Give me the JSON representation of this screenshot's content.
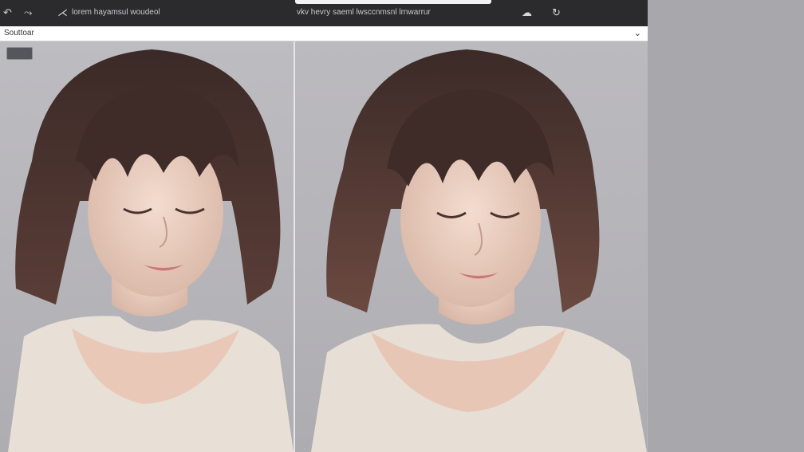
{
  "toolbar": {
    "title_text": "lorem hayamsul woudeol",
    "center_text": "vkv hevry saeml lwsccnmsnl lrnwarrur"
  },
  "tab": {
    "label": "Souttoar"
  },
  "icons": [
    "back-icon",
    "tools-icon",
    "branch-icon",
    "cloud-icon",
    "refresh-icon",
    "dropdown-icon"
  ],
  "colors": {
    "toolbar_bg": "#2b2b2e",
    "canvas_bg": "#b8b6bb",
    "sidebar_bg": "#a8a7ac"
  },
  "images": [
    {
      "subject": "portrait-woman-bob-hair-left"
    },
    {
      "subject": "portrait-woman-bob-hair-right"
    }
  ]
}
